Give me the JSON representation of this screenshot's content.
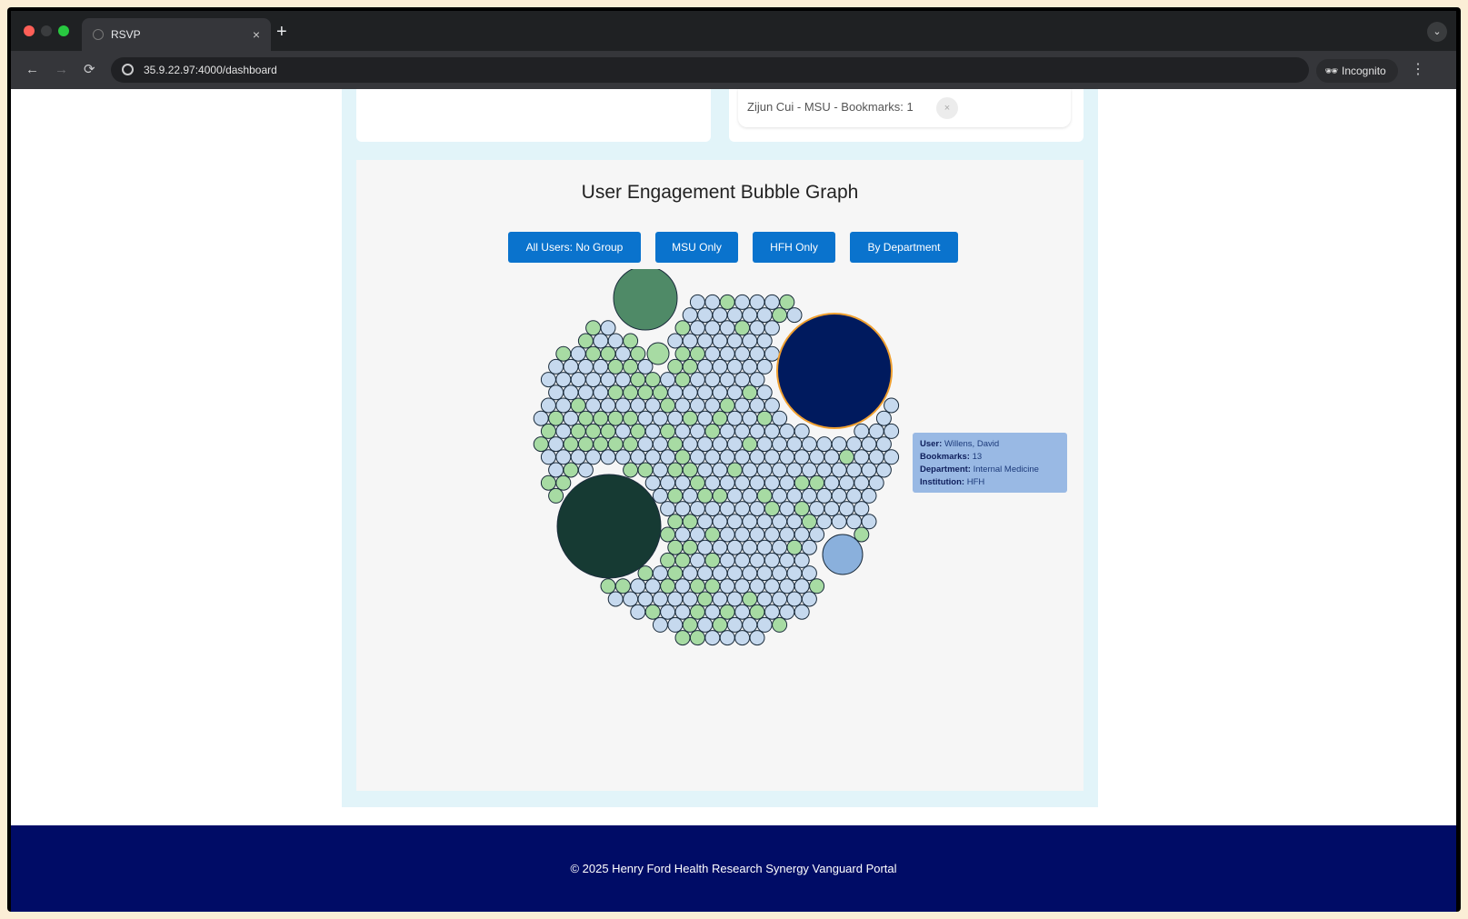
{
  "browser": {
    "tab_title": "RSVP",
    "tab_close": "×",
    "new_tab": "+",
    "url": "35.9.22.97:4000/dashboard",
    "incognito_label": "Incognito",
    "back_icon": "←",
    "forward_icon": "→",
    "reload_icon": "⟳",
    "menu_icon": "⋮",
    "tab_search_icon": "⌄"
  },
  "bookmarks": {
    "item_text": "Zijun Cui - MSU - Bookmarks: 1",
    "remove_glyph": "×"
  },
  "bubble_graph": {
    "title": "User Engagement Bubble Graph",
    "buttons": [
      "All Users: No Group",
      "MSU Only",
      "HFH Only",
      "By Department"
    ],
    "tooltip": {
      "user_key": "User:",
      "user_value": "Willens, David",
      "bookmarks_key": "Bookmarks:",
      "bookmarks_value": "13",
      "department_key": "Department:",
      "department_value": "Internal Medicine",
      "institution_key": "Institution:",
      "institution_value": "HFH"
    },
    "colors": {
      "small_blue": "#c6d9ee",
      "small_green": "#a7dba3",
      "highlight_navy": "#001a5e",
      "highlight_stroke": "#f0a030",
      "big_dark_green": "#163a33",
      "mid_green": "#4f8a67",
      "medium_blue": "#8ab0dc"
    }
  },
  "footer": {
    "text": "© 2025 Henry Ford Health Research Synergy Vanguard Portal"
  }
}
